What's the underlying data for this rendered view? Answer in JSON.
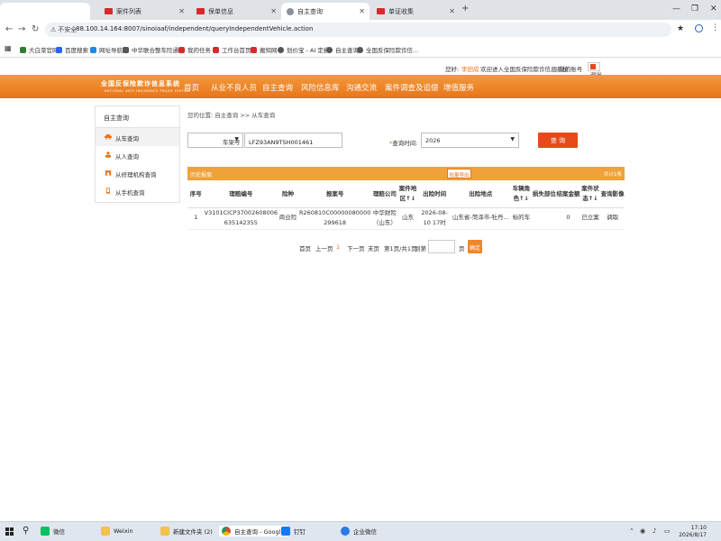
{
  "browser": {
    "tabs": [
      {
        "label": "",
        "active": false
      },
      {
        "label": "案件列表",
        "active": false
      },
      {
        "label": "保单信息",
        "active": false
      },
      {
        "label": "自主查询",
        "active": true
      },
      {
        "label": "单证收集",
        "active": false
      }
    ],
    "new_tab": "+",
    "insecure_label": "不安全",
    "url": "88.100.14.164:8007/sinoiaaf/independent/queryIndependentVehicle.action",
    "bookmarks": [
      "大白菜官网",
      "百度搜索",
      "网址导航",
      "中华联合整车险通...",
      "我的任务",
      "工作台首页",
      "搬知网",
      "划价宝 - AI 定损",
      "自主查询",
      "全国反保险欺诈信..."
    ]
  },
  "header": {
    "greeting": "您好:",
    "username": "李田成",
    "welcome": "欢迎进入全国反保险欺诈信息系统",
    "account": "| 我的账号",
    "logout": "退出"
  },
  "nav": {
    "logo": "全国反保险欺诈信息系统",
    "logo_sub": "NATIONAL ANTI INSURANCE FRAUD SYSTEM",
    "items": [
      "首页",
      "从业不良人员",
      "自主查询",
      "风险信息库",
      "沟通交流",
      "案件调查及追偿",
      "增值服务"
    ]
  },
  "sidebar": {
    "title": "自主查询",
    "items": [
      "从车查询",
      "从人查询",
      "从修理机构查询",
      "从手机查询"
    ]
  },
  "main": {
    "breadcrumb": "您的位置: 自主查询 >> 从车查询",
    "select_label": "车架号",
    "vin_value": "LFZ93AN9TSH001461",
    "time_label": "查询时间:",
    "time_required": "*",
    "time_value": "2026",
    "query_button": "查 询",
    "history_label": "历史报案",
    "export_button": "批量导出",
    "history_count": "共计1条"
  },
  "table": {
    "headers": [
      "序号",
      "理赔编号",
      "险种",
      "报案号",
      "理赔公司",
      "案件地区↑↓",
      "出险时间",
      "出险地点",
      "车辆角色↑↓",
      "损失部位",
      "结案金额",
      "案件状态↑↓",
      "查询影像"
    ],
    "rows": [
      [
        "1",
        "V3101CICP37002608006635142355",
        "商业险",
        "R260810C00000080000299618",
        "中华财险（山东）",
        "山东",
        "2026-08-10 17时",
        "山东省-菏泽市-牡丹...",
        "标的车",
        "",
        "0",
        "已立案",
        "调取"
      ]
    ]
  },
  "pager": {
    "first": "首页",
    "prev": "上一页",
    "current": "1",
    "next": "下一页",
    "last": "末页",
    "info": "第1页/共1页",
    "goto": "到第",
    "page_unit": "页",
    "confirm": "确定"
  },
  "taskbar": {
    "items": [
      "微信",
      "Weixin",
      "新建文件夹 (2)",
      "自主查询 - Googl...",
      "钉钉",
      "企业微信"
    ],
    "time": "17:10",
    "date": "2026/8/17"
  }
}
